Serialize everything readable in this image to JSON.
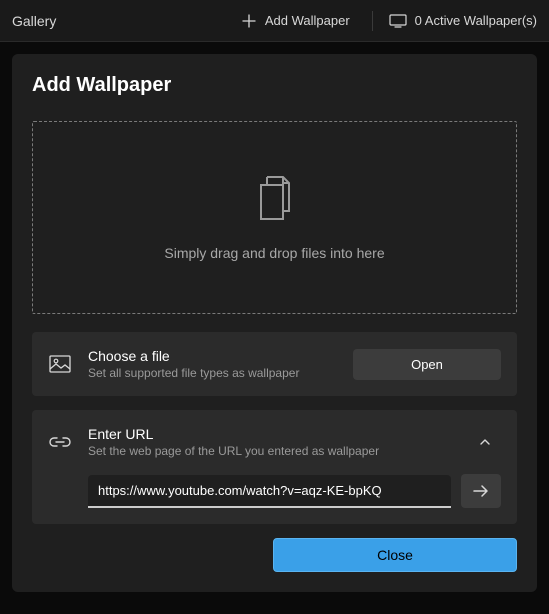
{
  "header": {
    "title": "Gallery",
    "add_wallpaper": "Add Wallpaper",
    "active_count": "0 Active Wallpaper(s)"
  },
  "dialog": {
    "title": "Add Wallpaper",
    "dropzone_text": "Simply drag and drop files into here",
    "choose_file": {
      "title": "Choose a file",
      "subtitle": "Set all supported file types as wallpaper",
      "button": "Open"
    },
    "enter_url": {
      "title": "Enter URL",
      "subtitle": "Set the web page of the URL you entered as wallpaper",
      "value": "https://www.youtube.com/watch?v=aqz-KE-bpKQ"
    },
    "close": "Close"
  }
}
